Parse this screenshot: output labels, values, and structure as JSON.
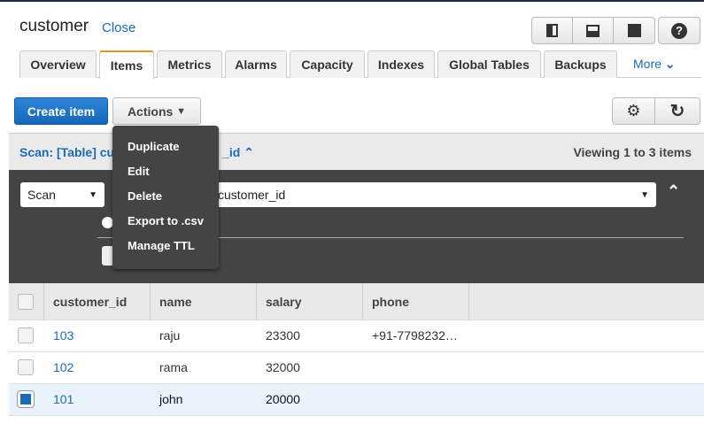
{
  "header": {
    "title": "customer",
    "close": "Close"
  },
  "tabs": [
    "Overview",
    "Items",
    "Metrics",
    "Alarms",
    "Capacity",
    "Indexes",
    "Global Tables",
    "Backups"
  ],
  "more": "More",
  "toolbar": {
    "create": "Create item",
    "actions": "Actions"
  },
  "scan": {
    "title_left": "Scan: [Table] cu",
    "title_right": "_id",
    "viewing": "Viewing 1 to 3 items",
    "mode": "Scan",
    "table": "customer_id"
  },
  "menu": [
    "Duplicate",
    "Edit",
    "Delete",
    "Export to .csv",
    "Manage TTL"
  ],
  "table": {
    "columns": [
      "customer_id",
      "name",
      "salary",
      "phone"
    ],
    "rows": [
      [
        "103",
        "raju",
        "23300",
        "+91-7798232…"
      ],
      [
        "102",
        "rama",
        "32000",
        ""
      ],
      [
        "101",
        "john",
        "20000",
        ""
      ]
    ],
    "selected_row": 2
  }
}
